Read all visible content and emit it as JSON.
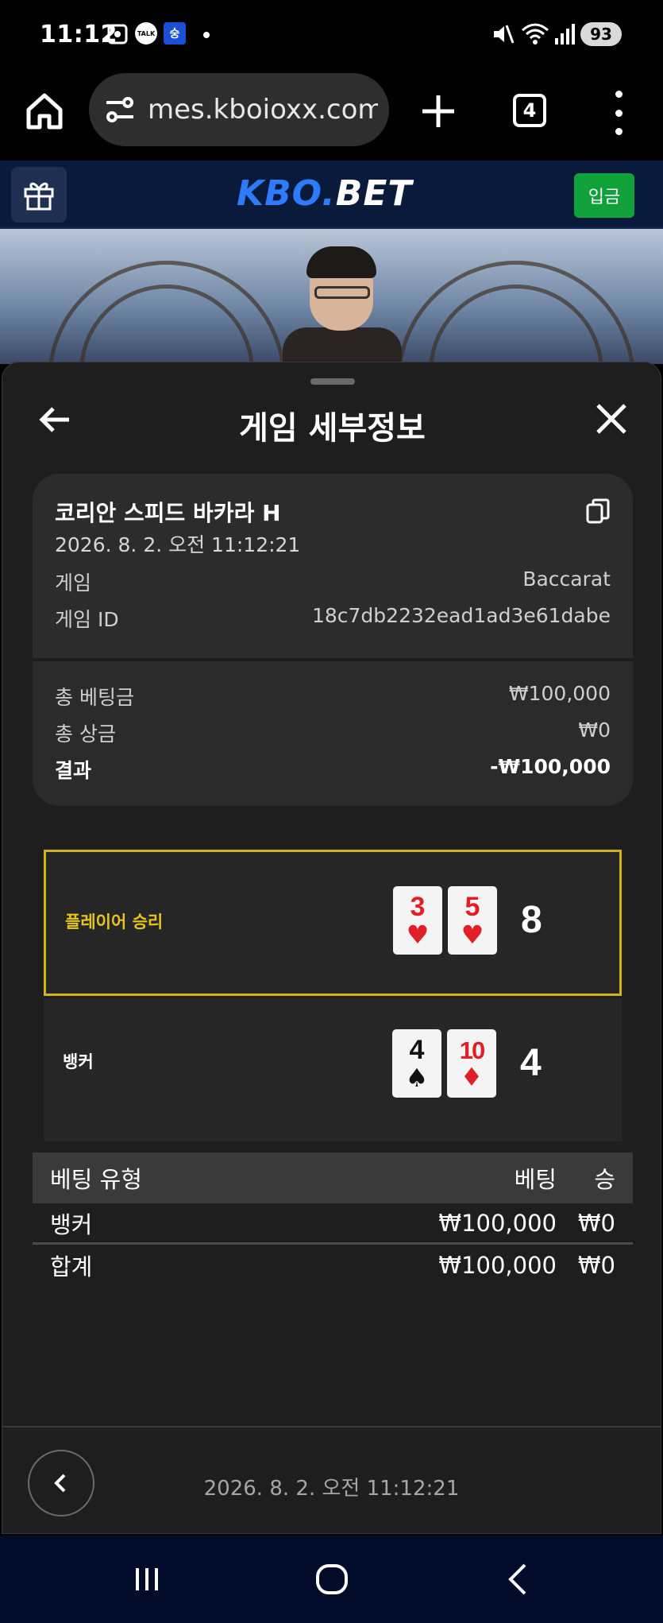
{
  "status_bar": {
    "time": "11:12",
    "talk_badge": "TALK",
    "news_badge": "숭",
    "battery": "93"
  },
  "browser": {
    "url": "mes.kboioxx.com",
    "tab_count": "4"
  },
  "site": {
    "logo_kbo": "KBO.",
    "logo_bet": "BET",
    "deposit_label": "입금",
    "brand_color": "#2f7bff"
  },
  "sheet": {
    "title": "게임 세부정보",
    "game_name": "코리안 스피드 바카라 H",
    "game_datetime": "2026. 8. 2. 오전 11:12:21",
    "rows": [
      {
        "label": "게임",
        "value": "Baccarat"
      },
      {
        "label": "게임 ID",
        "value": "18c7db2232ead1ad3e61dabe"
      }
    ],
    "totals": [
      {
        "label": "총 베팅금",
        "value": "₩100,000"
      },
      {
        "label": "총 상금",
        "value": "₩0"
      },
      {
        "label": "결과",
        "value": "-₩100,000"
      }
    ],
    "player": {
      "label": "플레이어 승리",
      "cards": [
        {
          "rank": "3",
          "suit": "♥",
          "color": "red"
        },
        {
          "rank": "5",
          "suit": "♥",
          "color": "red"
        }
      ],
      "score": "8",
      "highlight_color": "#d4b21c"
    },
    "banker": {
      "label": "뱅커",
      "cards": [
        {
          "rank": "4",
          "suit": "♠",
          "color": "black"
        },
        {
          "rank": "10",
          "suit": "♦",
          "color": "red"
        }
      ],
      "score": "4"
    },
    "bet_table": {
      "headers": [
        "베팅 유형",
        "베팅",
        "승"
      ],
      "rows": [
        [
          "뱅커",
          "₩100,000",
          "₩0"
        ],
        [
          "합계",
          "₩100,000",
          "₩0"
        ]
      ]
    },
    "footer_datetime": "2026. 8. 2. 오전 11:12:21"
  }
}
